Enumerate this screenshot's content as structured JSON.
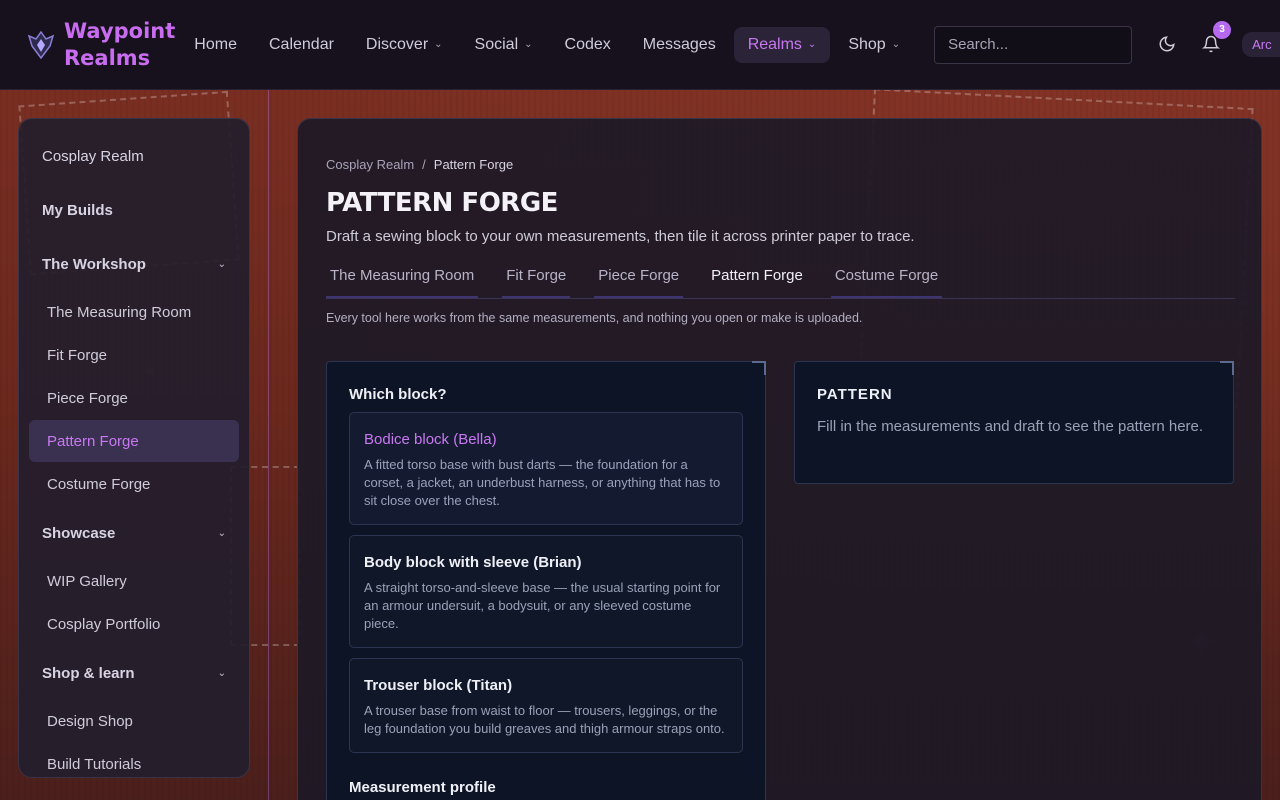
{
  "brand": {
    "name_line1": "Waypoint",
    "name_line2": "Realms"
  },
  "nav": {
    "items": [
      {
        "label": "Home",
        "dropdown": false,
        "active": false
      },
      {
        "label": "Calendar",
        "dropdown": false,
        "active": false
      },
      {
        "label": "Discover",
        "dropdown": true,
        "active": false
      },
      {
        "label": "Social",
        "dropdown": true,
        "active": false
      },
      {
        "label": "Codex",
        "dropdown": false,
        "active": false
      },
      {
        "label": "Messages",
        "dropdown": false,
        "active": false
      },
      {
        "label": "Realms",
        "dropdown": true,
        "active": true
      },
      {
        "label": "Shop",
        "dropdown": true,
        "active": false
      }
    ],
    "search_placeholder": "Search...",
    "notification_count": "3",
    "user_chip": "Arc"
  },
  "sidebar": {
    "top": "Cosplay Realm",
    "my_builds": "My Builds",
    "groups": [
      {
        "title": "The Workshop",
        "items": [
          "The Measuring Room",
          "Fit Forge",
          "Piece Forge",
          "Pattern Forge",
          "Costume Forge"
        ],
        "active_index": 3
      },
      {
        "title": "Showcase",
        "items": [
          "WIP Gallery",
          "Cosplay Portfolio"
        ]
      },
      {
        "title": "Shop & learn",
        "items": [
          "Design Shop",
          "Build Tutorials"
        ]
      }
    ]
  },
  "main": {
    "breadcrumb": {
      "parent": "Cosplay Realm",
      "separator": "/",
      "current": "Pattern Forge"
    },
    "title": "PATTERN FORGE",
    "subtitle": "Draft a sewing block to your own measurements, then tile it across printer paper to trace.",
    "tabs": [
      "The Measuring Room",
      "Fit Forge",
      "Piece Forge",
      "Pattern Forge",
      "Costume Forge"
    ],
    "active_tab": 3,
    "note": "Every tool here works from the same measurements, and nothing you open or make is uploaded.",
    "block_chooser": {
      "label": "Which block?",
      "options": [
        {
          "title": "Bodice block (Bella)",
          "desc": "A fitted torso base with bust darts — the foundation for a corset, a jacket, an underbust harness, or anything that has to sit close over the chest."
        },
        {
          "title": "Body block with sleeve (Brian)",
          "desc": "A straight torso-and-sleeve base — the usual starting point for an armour undersuit, a bodysuit, or any sleeved costume piece."
        },
        {
          "title": "Trouser block (Titan)",
          "desc": "A trouser base from waist to floor — trousers, leggings, or the leg foundation you build greaves and thigh armour straps onto."
        }
      ],
      "selected_index": 0,
      "profile_label": "Measurement profile"
    },
    "pattern": {
      "title": "PATTERN",
      "text": "Fill in the measurements and draft to see the pattern here."
    }
  }
}
